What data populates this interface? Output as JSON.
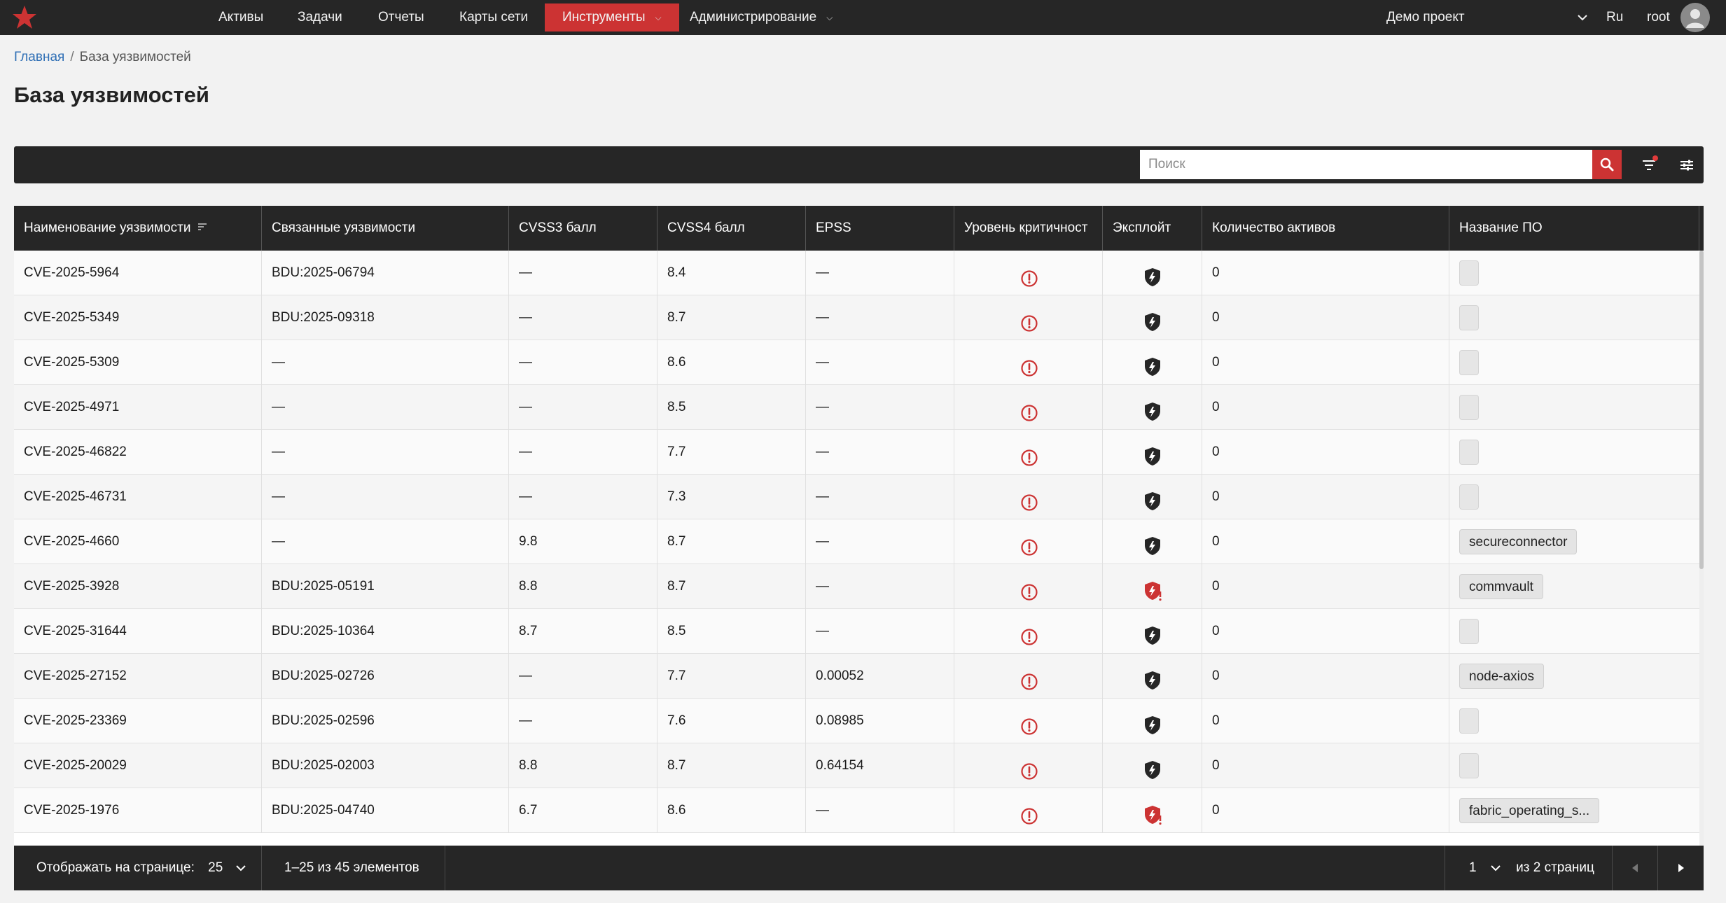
{
  "header": {
    "nav": [
      {
        "label": "Активы",
        "has_dropdown": false
      },
      {
        "label": "Задачи",
        "has_dropdown": false
      },
      {
        "label": "Отчеты",
        "has_dropdown": false
      },
      {
        "label": "Карты сети",
        "has_dropdown": false
      },
      {
        "label": "Инструменты",
        "has_dropdown": true,
        "active": true
      },
      {
        "label": "Администрирование",
        "has_dropdown": true
      }
    ],
    "project": "Демо проект",
    "lang": "Ru",
    "user": "root"
  },
  "breadcrumb": {
    "home": "Главная",
    "separator": "/",
    "current": "База уязвимостей"
  },
  "page_title": "База уязвимостей",
  "search": {
    "placeholder": "Поиск",
    "value": ""
  },
  "table": {
    "columns": [
      "Наименование уязвимости",
      "Связанные уязвимости",
      "CVSS3 балл",
      "CVSS4 балл",
      "EPSS",
      "Уровень критичност",
      "Эксплойт",
      "Количество активов",
      "Название ПО"
    ],
    "rows": [
      {
        "name": "CVE-2025-5964",
        "related": "BDU:2025-06794",
        "cvss3": "—",
        "cvss4": "8.4",
        "epss": "—",
        "exploit": "shield-icon",
        "assets": "0",
        "software": ""
      },
      {
        "name": "CVE-2025-5349",
        "related": "BDU:2025-09318",
        "cvss3": "—",
        "cvss4": "8.7",
        "epss": "—",
        "exploit": "shield-icon",
        "assets": "0",
        "software": ""
      },
      {
        "name": "CVE-2025-5309",
        "related": "—",
        "cvss3": "—",
        "cvss4": "8.6",
        "epss": "—",
        "exploit": "shield-icon",
        "assets": "0",
        "software": ""
      },
      {
        "name": "CVE-2025-4971",
        "related": "—",
        "cvss3": "—",
        "cvss4": "8.5",
        "epss": "—",
        "exploit": "shield-icon",
        "assets": "0",
        "software": ""
      },
      {
        "name": "CVE-2025-46822",
        "related": "—",
        "cvss3": "—",
        "cvss4": "7.7",
        "epss": "—",
        "exploit": "shield-icon",
        "assets": "0",
        "software": ""
      },
      {
        "name": "CVE-2025-46731",
        "related": "—",
        "cvss3": "—",
        "cvss4": "7.3",
        "epss": "—",
        "exploit": "shield-icon",
        "assets": "0",
        "software": ""
      },
      {
        "name": "CVE-2025-4660",
        "related": "—",
        "cvss3": "9.8",
        "cvss4": "8.7",
        "epss": "—",
        "exploit": "shield-icon",
        "assets": "0",
        "software": "secureconnector"
      },
      {
        "name": "CVE-2025-3928",
        "related": "BDU:2025-05191",
        "cvss3": "8.8",
        "cvss4": "8.7",
        "epss": "—",
        "exploit": "shield-alert-icon",
        "assets": "0",
        "software": "commvault"
      },
      {
        "name": "CVE-2025-31644",
        "related": "BDU:2025-10364",
        "cvss3": "8.7",
        "cvss4": "8.5",
        "epss": "—",
        "exploit": "shield-icon",
        "assets": "0",
        "software": ""
      },
      {
        "name": "CVE-2025-27152",
        "related": "BDU:2025-02726",
        "cvss3": "—",
        "cvss4": "7.7",
        "epss": "0.00052",
        "exploit": "shield-icon",
        "assets": "0",
        "software": "node-axios"
      },
      {
        "name": "CVE-2025-23369",
        "related": "BDU:2025-02596",
        "cvss3": "—",
        "cvss4": "7.6",
        "epss": "0.08985",
        "exploit": "shield-icon",
        "assets": "0",
        "software": ""
      },
      {
        "name": "CVE-2025-20029",
        "related": "BDU:2025-02003",
        "cvss3": "8.8",
        "cvss4": "8.7",
        "epss": "0.64154",
        "exploit": "shield-icon",
        "assets": "0",
        "software": ""
      },
      {
        "name": "CVE-2025-1976",
        "related": "BDU:2025-04740",
        "cvss3": "6.7",
        "cvss4": "8.6",
        "epss": "—",
        "exploit": "shield-alert-icon",
        "assets": "0",
        "software": "fabric_operating_s..."
      }
    ]
  },
  "pagination": {
    "per_page_label": "Отображать на странице:",
    "per_page": "25",
    "range": "1–25 из 45 элементов",
    "page": "1",
    "total_pages": "из 2 страниц"
  },
  "colors": {
    "accent": "#cc3333",
    "dark": "#262626",
    "link": "#2f6fb5"
  }
}
